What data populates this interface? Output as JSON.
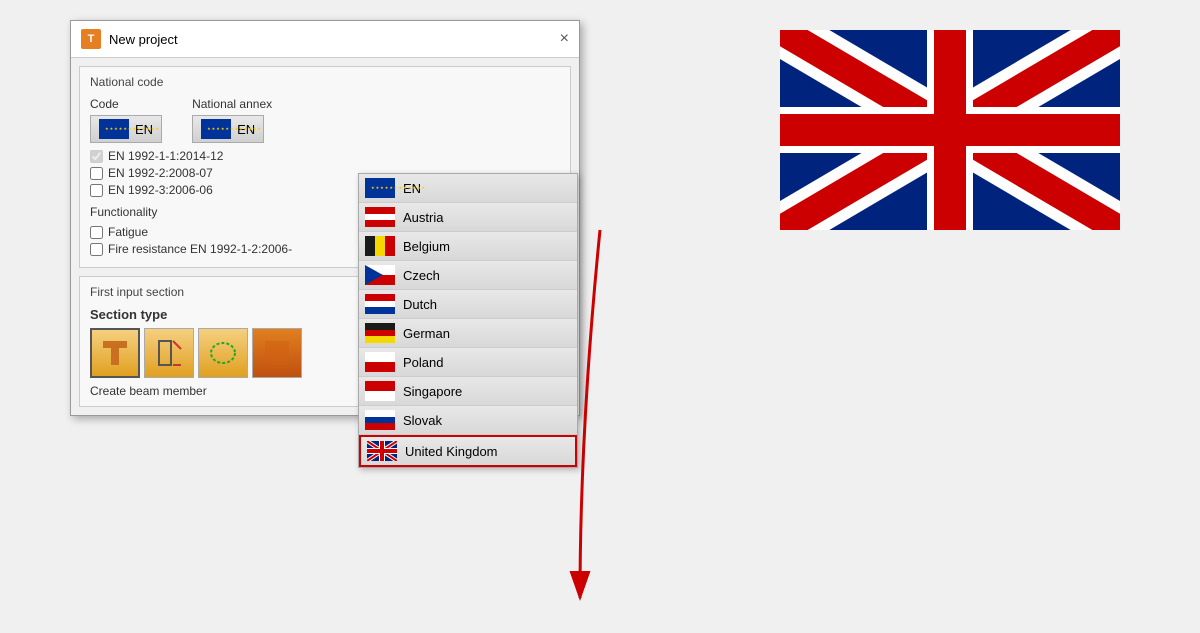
{
  "dialog": {
    "title": "New project",
    "close_label": "×"
  },
  "national_code": {
    "section_title": "National code",
    "code_label": "Code",
    "code_value": "EN",
    "national_annex_label": "National annex",
    "national_annex_value": "EN",
    "checkboxes": [
      {
        "label": "EN 1992-1-1:2014-12",
        "checked": true,
        "disabled": true
      },
      {
        "label": "EN 1992-2:2008-07",
        "checked": false,
        "disabled": false
      },
      {
        "label": "EN 1992-3:2006-06",
        "checked": false,
        "disabled": false
      }
    ],
    "functionality_label": "Functionality",
    "functionality_items": [
      {
        "label": "Fatigue",
        "checked": false
      },
      {
        "label": "Fire resistance EN 1992-1-2:2006-",
        "checked": false
      }
    ]
  },
  "first_input_section": {
    "section_title": "First input section",
    "section_type_label": "Section type",
    "create_beam_label": "Create beam member"
  },
  "dropdown": {
    "items": [
      {
        "id": "en",
        "label": "EN",
        "flag_type": "eu"
      },
      {
        "id": "austria",
        "label": "Austria",
        "flag_type": "austria"
      },
      {
        "id": "belgium",
        "label": "Belgium",
        "flag_type": "belgium"
      },
      {
        "id": "czech",
        "label": "Czech",
        "flag_type": "czech"
      },
      {
        "id": "dutch",
        "label": "Dutch",
        "flag_type": "dutch"
      },
      {
        "id": "german",
        "label": "German",
        "flag_type": "german"
      },
      {
        "id": "poland",
        "label": "Poland",
        "flag_type": "poland"
      },
      {
        "id": "singapore",
        "label": "Singapore",
        "flag_type": "singapore"
      },
      {
        "id": "slovak",
        "label": "Slovak",
        "flag_type": "slovak"
      },
      {
        "id": "united_kingdom",
        "label": "United Kingdom",
        "flag_type": "uk",
        "highlighted": true
      }
    ]
  },
  "app_icon_label": "T",
  "colors": {
    "accent": "#e67e22",
    "highlight_border": "#cc0000"
  }
}
